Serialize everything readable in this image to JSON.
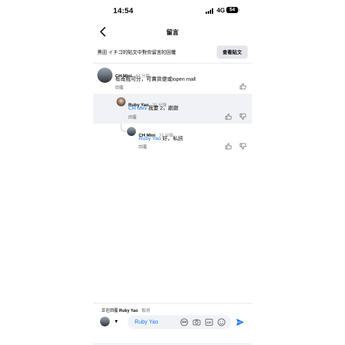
{
  "status": {
    "time": "14:54",
    "network": "4G",
    "battery": "54"
  },
  "header": {
    "title": "留言",
    "back_icon": "chevron-left-icon"
  },
  "context": {
    "text": "黑田 イチゴ的貼文中對你留言的回覆",
    "view_post": "查看貼文"
  },
  "comments": [
    {
      "name": "CH Mini",
      "time": " · 44 分鐘",
      "mention": "",
      "text": "有南瓶可分，可賣貨便或iopen mall",
      "reply": "回覆"
    },
    {
      "name": "Ruby Yao",
      "time": " · 39 分鐘",
      "mention": "CH Mini",
      "text": " 我要 2，謝謝",
      "reply": "回覆"
    },
    {
      "name": "CH Mini",
      "time": " · 37 分鐘",
      "mention": "Ruby Yao",
      "text": " 好，私訊",
      "reply": "回覆"
    }
  ],
  "composer": {
    "replying_prefix": "正在回覆 ",
    "replying_name": "Ruby Yao",
    "cancel": " · 取消",
    "input_value": "Ruby Yao",
    "icons": [
      "avatar-sticker-icon",
      "camera-icon",
      "gif-icon",
      "emoji-icon"
    ],
    "send_icon": "send-icon"
  },
  "colors": {
    "accent": "#1877f2",
    "highlight": "#f0f2f5"
  }
}
